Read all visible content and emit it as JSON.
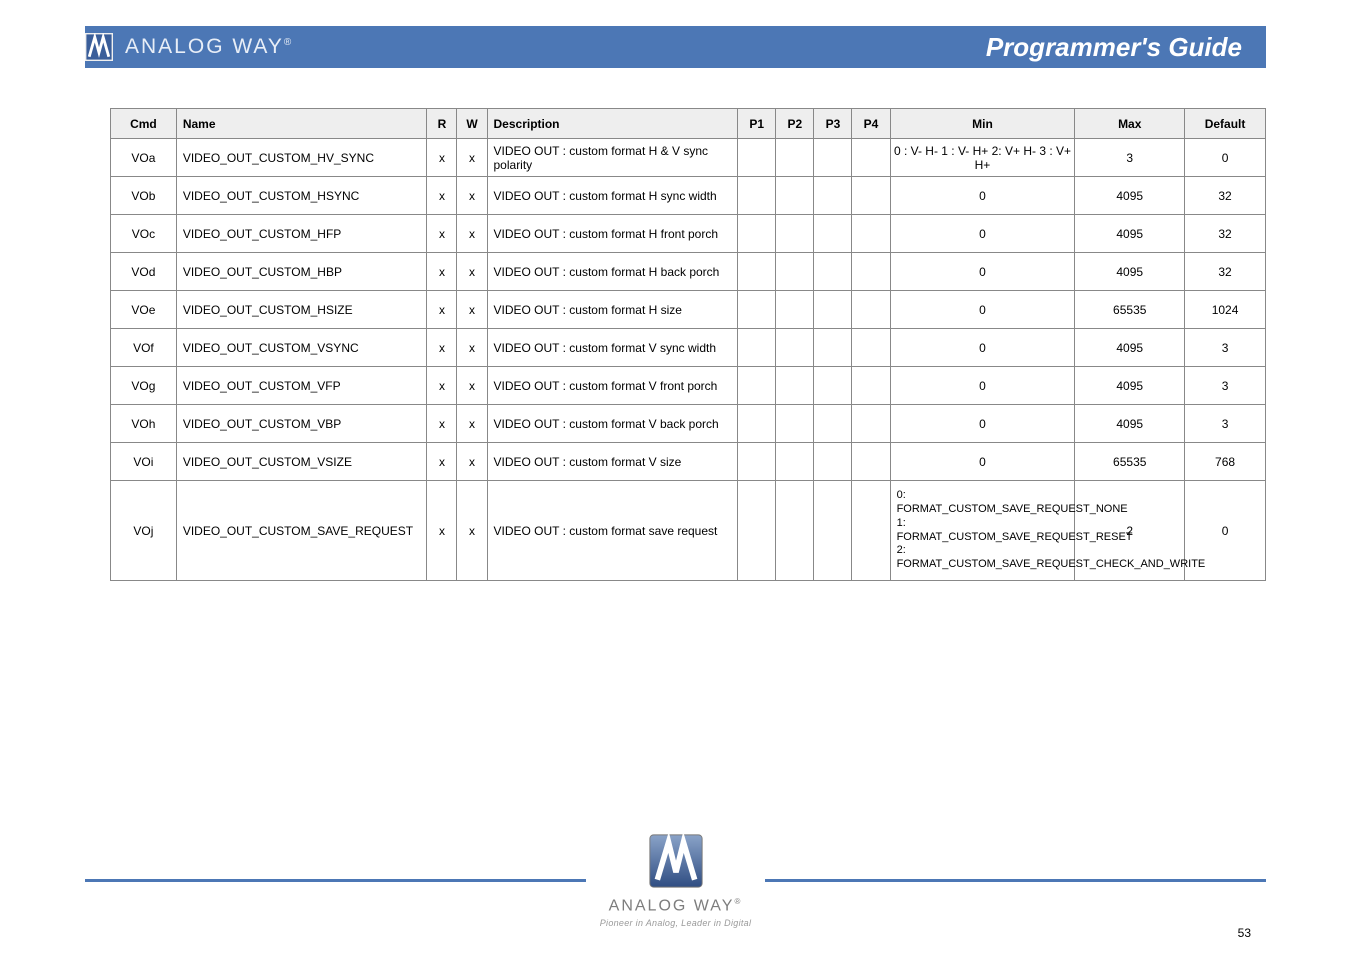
{
  "header": {
    "brand": "ANALOG WAY",
    "brand_sup": "®",
    "title": "Programmer's Guide"
  },
  "table": {
    "headers": [
      "Cmd",
      "Name",
      "R",
      "W",
      "Description",
      "P1",
      "P2",
      "P3",
      "P4",
      "Min",
      "Max",
      "Default"
    ],
    "rows": [
      {
        "cmd": "VOa",
        "name": "VIDEO_OUT_CUSTOM_HV_SYNC",
        "r": "x",
        "w": "x",
        "desc": "VIDEO OUT : custom format H & V sync polarity",
        "p1": "",
        "p2": "",
        "p3": "",
        "p4": "",
        "min": "0 : V- H- 1 : V- H+ 2: V+ H- 3 : V+ H+",
        "max": "3",
        "def": "0"
      },
      {
        "cmd": "VOb",
        "name": "VIDEO_OUT_CUSTOM_HSYNC",
        "r": "x",
        "w": "x",
        "desc": "VIDEO OUT : custom format H sync width",
        "p1": "",
        "p2": "",
        "p3": "",
        "p4": "",
        "min": "0",
        "max": "4095",
        "def": "32"
      },
      {
        "cmd": "VOc",
        "name": "VIDEO_OUT_CUSTOM_HFP",
        "r": "x",
        "w": "x",
        "desc": "VIDEO OUT : custom format H front porch",
        "p1": "",
        "p2": "",
        "p3": "",
        "p4": "",
        "min": "0",
        "max": "4095",
        "def": "32"
      },
      {
        "cmd": "VOd",
        "name": "VIDEO_OUT_CUSTOM_HBP",
        "r": "x",
        "w": "x",
        "desc": "VIDEO OUT : custom format H back porch",
        "p1": "",
        "p2": "",
        "p3": "",
        "p4": "",
        "min": "0",
        "max": "4095",
        "def": "32"
      },
      {
        "cmd": "VOe",
        "name": "VIDEO_OUT_CUSTOM_HSIZE",
        "r": "x",
        "w": "x",
        "desc": "VIDEO OUT : custom format H size",
        "p1": "",
        "p2": "",
        "p3": "",
        "p4": "",
        "min": "0",
        "max": "65535",
        "def": "1024"
      },
      {
        "cmd": "VOf",
        "name": "VIDEO_OUT_CUSTOM_VSYNC",
        "r": "x",
        "w": "x",
        "desc": "VIDEO OUT : custom format V sync width",
        "p1": "",
        "p2": "",
        "p3": "",
        "p4": "",
        "min": "0",
        "max": "4095",
        "def": "3"
      },
      {
        "cmd": "VOg",
        "name": "VIDEO_OUT_CUSTOM_VFP",
        "r": "x",
        "w": "x",
        "desc": "VIDEO OUT : custom format V front porch",
        "p1": "",
        "p2": "",
        "p3": "",
        "p4": "",
        "min": "0",
        "max": "4095",
        "def": "3"
      },
      {
        "cmd": "VOh",
        "name": "VIDEO_OUT_CUSTOM_VBP",
        "r": "x",
        "w": "x",
        "desc": "VIDEO OUT : custom format V back porch",
        "p1": "",
        "p2": "",
        "p3": "",
        "p4": "",
        "min": "0",
        "max": "4095",
        "def": "3"
      },
      {
        "cmd": "VOi",
        "name": "VIDEO_OUT_CUSTOM_VSIZE",
        "r": "x",
        "w": "x",
        "desc": "VIDEO OUT : custom format V size",
        "p1": "",
        "p2": "",
        "p3": "",
        "p4": "",
        "min": "0",
        "max": "65535",
        "def": "768"
      },
      {
        "cmd": "VOj",
        "name": "VIDEO_OUT_CUSTOM_SAVE_REQUEST",
        "r": "x",
        "w": "x",
        "desc": "VIDEO OUT : custom format save request",
        "p1": "",
        "p2": "",
        "p3": "",
        "p4": "",
        "min_multi": [
          "0: FORMAT_CUSTOM_SAVE_REQUEST_NONE",
          "1: FORMAT_CUSTOM_SAVE_REQUEST_RESET",
          "2: FORMAT_CUSTOM_SAVE_REQUEST_CHECK_AND_WRITE"
        ],
        "max": "2",
        "def": "0"
      }
    ]
  },
  "footer": {
    "brand": "ANALOG WAY",
    "brand_sup": "®",
    "tagline": "Pioneer in Analog, Leader in Digital"
  },
  "page_number": "53"
}
